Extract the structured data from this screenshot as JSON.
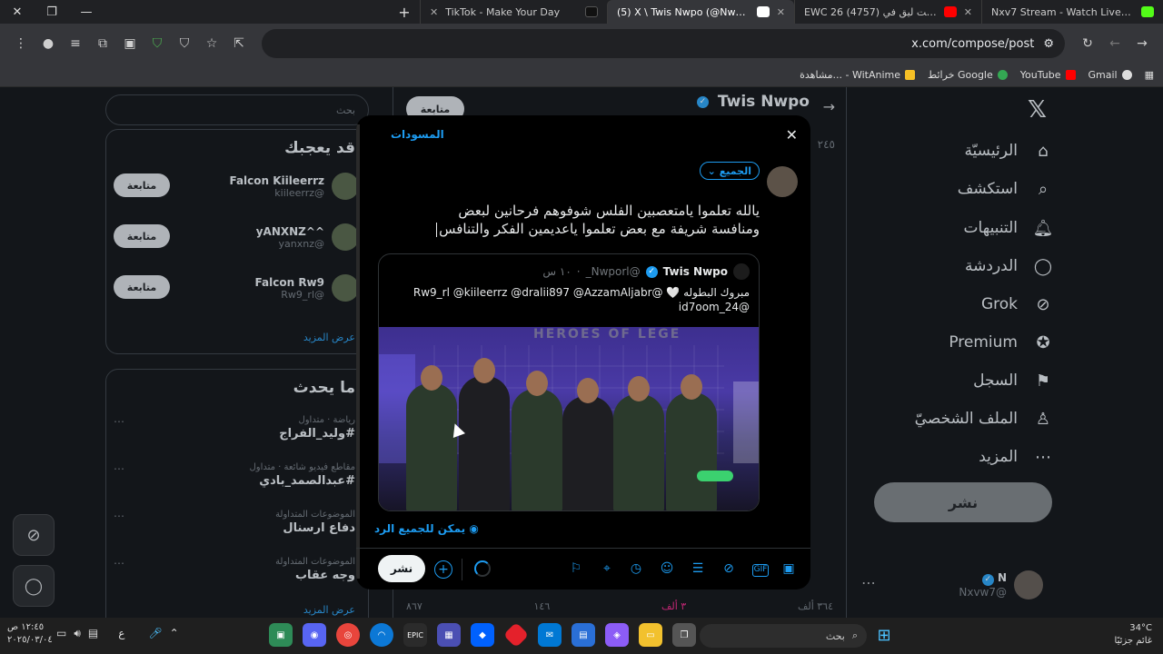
{
  "browser": {
    "tabs": [
      {
        "title": "TikTok - Make Your Day",
        "fav_color": "#111111",
        "active": false
      },
      {
        "title": "(5) X \\ Twis Nwpo (@Nwporl_)",
        "fav_color": "#ffffff",
        "active": true
      },
      {
        "title": "EWC 26 روكيت ليق في (4757) -",
        "fav_color": "#ff0000",
        "active": false
      },
      {
        "title": "Nxv7 Stream - Watch Live on Kick",
        "fav_color": "#53fc18",
        "active": false
      }
    ],
    "url": "x.com/compose/post",
    "bookmarks": [
      "Gmail",
      "YouTube",
      "خرائط Google",
      "مشاهدة... - WitAnime"
    ]
  },
  "nav": {
    "items": [
      {
        "label": "الرئيسيّة",
        "icon": "home-icon"
      },
      {
        "label": "استكشف",
        "icon": "search-icon"
      },
      {
        "label": "التنبيهات",
        "icon": "bell-icon"
      },
      {
        "label": "الدردشة",
        "icon": "chat-icon"
      },
      {
        "label": "Grok",
        "icon": "grok-icon"
      },
      {
        "label": "Premium",
        "icon": "premium-icon"
      },
      {
        "label": "السجل",
        "icon": "bookmark-icon"
      },
      {
        "label": "الملف الشخصيّ",
        "icon": "profile-icon"
      },
      {
        "label": "المزيد",
        "icon": "more-icon"
      }
    ],
    "post_button": "نشر",
    "account": {
      "name": "N",
      "handle": "@Nxvw7"
    }
  },
  "profile_header": {
    "name": "Twis Nwpo",
    "posts_count": "٢٤٥",
    "follow_label": "متابعة",
    "stats": [
      "٨٦٧",
      "١٤٦",
      "٣ ألف",
      "٣٦٤ ألف"
    ]
  },
  "right_column": {
    "search_placeholder": "بحث",
    "who_to_follow": {
      "title": "قد يعجبك",
      "users": [
        {
          "name": "Falcon Kiileerrz",
          "handle": "@kiileerrz",
          "button": "متابعة"
        },
        {
          "name": "^^yANXNZ",
          "handle": "@yanxnz",
          "button": "متابعة"
        },
        {
          "name": "Falcon Rw9",
          "handle": "@Rw9_rl",
          "button": "متابعة"
        }
      ],
      "show_more": "عرض المزيد"
    },
    "trends": {
      "title": "ما يحدث",
      "items": [
        {
          "category": "رياضة · متداول",
          "title": "#وليد_الفراج"
        },
        {
          "category": "مقاطع فيديو شائعة · متداول",
          "title": "#عبدالصمد_بادي"
        },
        {
          "category": "الموضوعات المتداولة",
          "title": "دفاع ارسنال"
        },
        {
          "category": "الموضوعات المتداولة",
          "title": "وجه عقاب"
        }
      ],
      "show_more": "عرض المزيد"
    }
  },
  "modal": {
    "drafts_label": "المسودات",
    "audience_label": "الجميع",
    "composer_text_line1": "يالله تعلموا يامتعصبين الفلس شوفوهم فرحانين لبعض",
    "composer_text_line2": "ومنافسة شريفة مع بعض تعلموا ياعديمين الفكر والتنافس",
    "quote": {
      "name": "Twis Nwpo",
      "handle": "@Nwporl_",
      "time": "١٠ س",
      "text_line1": "مبروك البطوله 🤍 @Rw9_rl @kiileerrz @dralii897 @AzzamAljabr",
      "text_line2": "@id7oom_24",
      "image_banner": "HEROES OF LEGE"
    },
    "reply_setting": "يمكن للجميع الرد",
    "post_button": "نشر"
  },
  "taskbar": {
    "time": "١٢:٤٥ ص",
    "date": "٢٠٢٥/٠٣/٠٤",
    "lang": "ع",
    "search": "بحث",
    "weather_temp": "34°C",
    "weather_desc": "غائم جزئيًا"
  }
}
